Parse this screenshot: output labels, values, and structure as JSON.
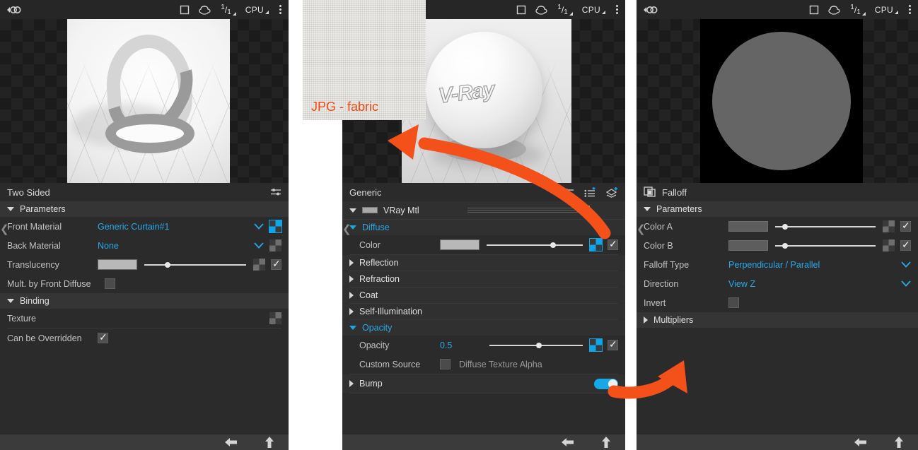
{
  "app": {
    "titlebar": {
      "vray_logo_icon": "vray-logo-icon",
      "render_region_icon": "square-icon",
      "teapot_icon": "teapot-icon",
      "frame_num": "1",
      "frame_den": "1",
      "engine_label": "CPU",
      "more_icon": "kebab-menu-icon"
    },
    "bottombar": {
      "back_label": "←",
      "up_label": "↑"
    }
  },
  "panels": {
    "left": {
      "preview": {
        "name": "material-preview-mobius",
        "alt": "Mobius ring material preview"
      },
      "rollout_title": "Two Sided",
      "rollout_icon": "sliders-icon",
      "sections": [
        {
          "label": "Parameters",
          "expanded": true
        },
        {
          "label": "Binding",
          "expanded": true
        }
      ],
      "rows": [
        {
          "label": "Front Material",
          "value": "Generic Curtain#1",
          "value_style": "blue",
          "chevron": true,
          "map_active": true
        },
        {
          "label": "Back Material",
          "value": "None",
          "value_style": "blue",
          "chevron": true,
          "map_active": false
        },
        {
          "label": "Translucency",
          "swatch": "#b8b8b8",
          "slider": 0.2,
          "map_active": false,
          "checked": true
        },
        {
          "label": "Mult. by Front Diffuse",
          "checkbox": false
        },
        {
          "label": "Texture",
          "map_active": false
        },
        {
          "label": "Can be Overridden",
          "checkbox": true
        }
      ]
    },
    "middle": {
      "preview": {
        "name": "material-preview-vray-sphere",
        "sphere_text": "V-Ray"
      },
      "annotation_swatch": {
        "label": "JPG - fabric",
        "color": "#f04813"
      },
      "rollout_title": "Generic",
      "header_icons": [
        "sliders-icon",
        "add-list-icon",
        "import-map-icon"
      ],
      "material_row": {
        "label": "VRay Mtl",
        "more_icon": "kebab-menu-icon"
      },
      "sections": [
        {
          "label": "Diffuse",
          "expanded": true,
          "accent": true
        },
        {
          "label": "Reflection",
          "expanded": false
        },
        {
          "label": "Refraction",
          "expanded": false
        },
        {
          "label": "Coat",
          "expanded": false
        },
        {
          "label": "Self-Illumination",
          "expanded": false
        },
        {
          "label": "Opacity",
          "expanded": true,
          "accent": true
        },
        {
          "label": "Bump",
          "expanded": false,
          "toggle": true
        }
      ],
      "rows": {
        "color": {
          "label": "Color",
          "swatch": "#c6c6c6",
          "slider": 0.66,
          "map_active": true,
          "checked": true
        },
        "opacity": {
          "label": "Opacity",
          "value": "0.5",
          "slider": 0.5,
          "map_active": true,
          "checked": true
        },
        "custom_source": {
          "label": "Custom Source",
          "checkbox": false,
          "value": "Diffuse Texture Alpha"
        }
      }
    },
    "right": {
      "preview": {
        "name": "map-preview-falloff",
        "alt": "Falloff map preview"
      },
      "rollout_title": "Falloff",
      "rollout_icon": "falloff-map-icon",
      "sections": [
        {
          "label": "Parameters",
          "expanded": true
        },
        {
          "label": "Multipliers",
          "expanded": false
        }
      ],
      "rows": [
        {
          "label": "Color A",
          "swatch": "#5d5d5d",
          "slider": 0.07,
          "map_active": false,
          "checked": true
        },
        {
          "label": "Color B",
          "swatch": "#5d5d5d",
          "slider": 0.07,
          "map_active": false,
          "checked": true
        },
        {
          "label": "Falloff Type",
          "value": "Perpendicular / Parallel",
          "value_style": "blue",
          "chevron": true
        },
        {
          "label": "Direction",
          "value": "View Z",
          "value_style": "blue",
          "chevron": true
        },
        {
          "label": "Invert",
          "checkbox": false
        }
      ]
    }
  },
  "annotations": {
    "arrow_color": "#f04813",
    "arrows": [
      {
        "name": "arrow-to-fabric-swatch",
        "from": "generic-rollout-header",
        "to": "fabric-swatch"
      },
      {
        "name": "arrow-to-falloff-panel",
        "from": "opacity-map-button",
        "to": "falloff-parameters"
      }
    ]
  }
}
